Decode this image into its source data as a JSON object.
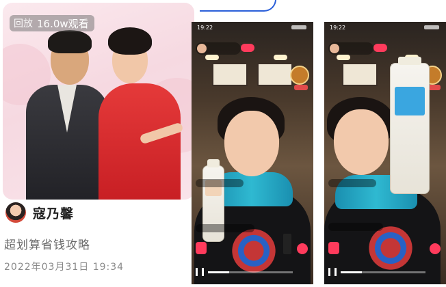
{
  "card": {
    "replay_label": "回放",
    "views": "16.0w观看",
    "author": "寇乃馨",
    "description": "超划算省钱攻略",
    "datetime": "2022年03月31日 19:34"
  },
  "phones": [
    {
      "status_time": "19:22"
    },
    {
      "status_time": "19:22"
    }
  ],
  "colors": {
    "accent_red": "#ff3b5c",
    "outline_blue": "#2b5fd9"
  }
}
